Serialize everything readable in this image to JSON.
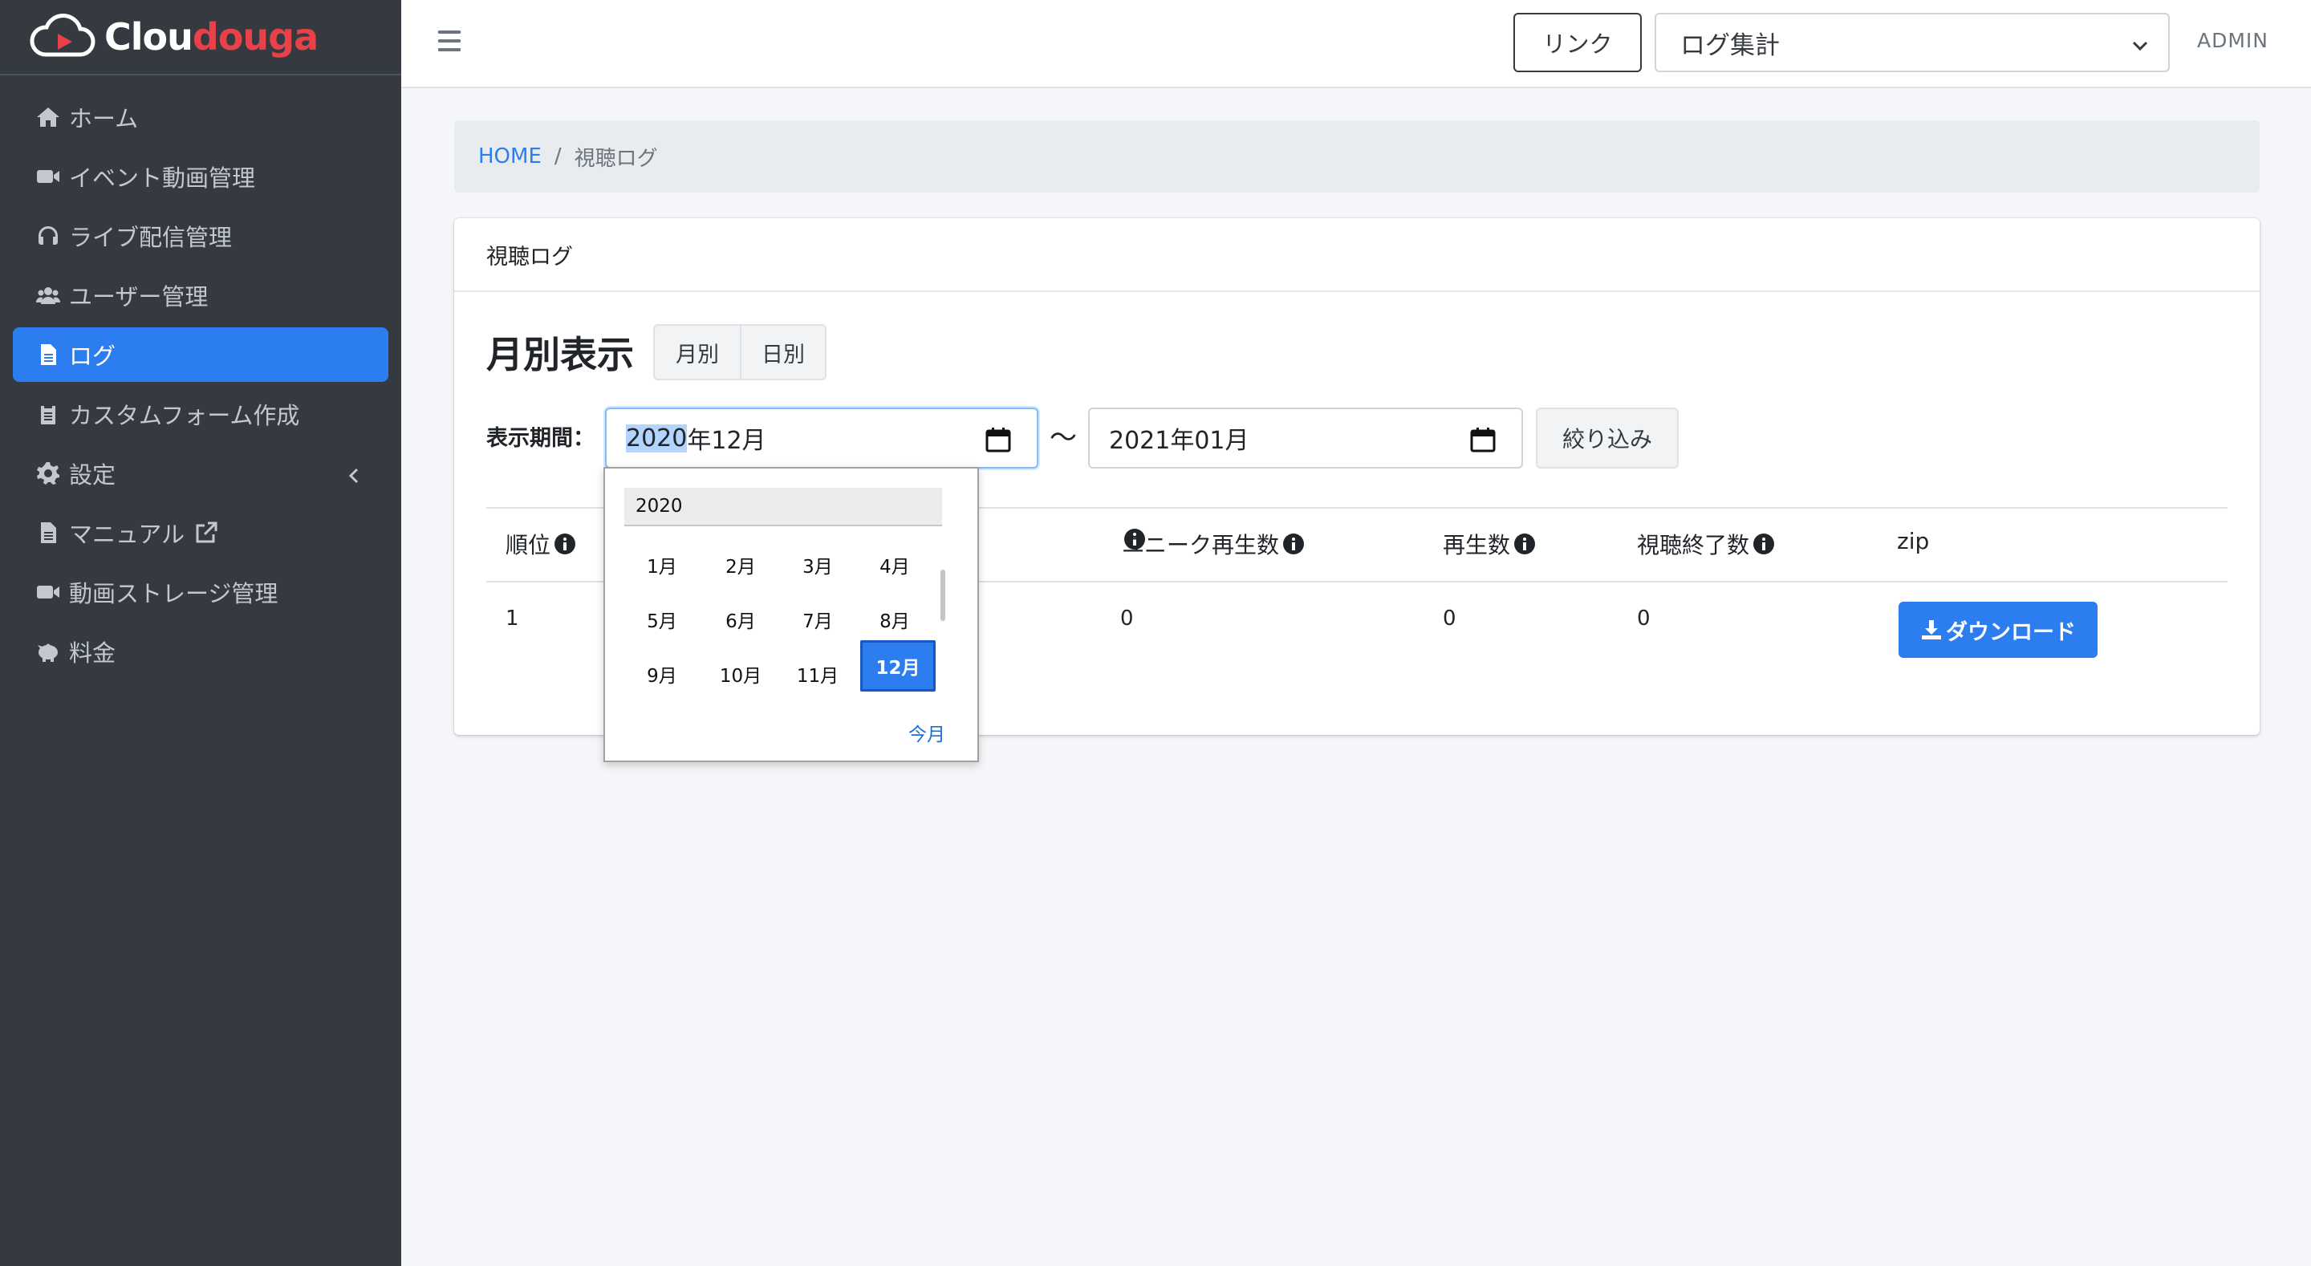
{
  "brand": {
    "name_part1": "Clou",
    "name_part2": "douga",
    "colors": {
      "accent": "#e8414a",
      "primary": "#2c7ef0",
      "sidebar_bg": "#343a40"
    }
  },
  "sidebar": {
    "items": [
      {
        "label": "ホーム",
        "icon": "home-icon"
      },
      {
        "label": "イベント動画管理",
        "icon": "video-camera-icon"
      },
      {
        "label": "ライブ配信管理",
        "icon": "headset-icon"
      },
      {
        "label": "ユーザー管理",
        "icon": "users-icon"
      },
      {
        "label": "ログ",
        "icon": "file-icon",
        "active": true
      },
      {
        "label": "カスタムフォーム作成",
        "icon": "clipboard-icon"
      },
      {
        "label": "設定",
        "icon": "gear-icon"
      },
      {
        "label": "マニュアル",
        "icon": "file-icon"
      },
      {
        "label": "動画ストレージ管理",
        "icon": "video-camera-icon"
      },
      {
        "label": "料金",
        "icon": "piggy-bank-icon"
      }
    ]
  },
  "header": {
    "link_button": "リンク",
    "select_value": "ログ集計",
    "user": "ADMIN"
  },
  "breadcrumb": {
    "home": "HOME",
    "separator": "/",
    "current": "視聴ログ"
  },
  "card": {
    "title": "視聴ログ",
    "section_title": "月別表示",
    "toggle": {
      "monthly": "月別",
      "daily": "日別"
    },
    "period_label": "表示期間：",
    "start_date": {
      "year": "2020",
      "rest": "年12月"
    },
    "tilde": "〜",
    "end_date": "2021年01月",
    "filter_button": "絞り込み"
  },
  "table": {
    "headers": {
      "rank": "順位",
      "unique_plays": "ユニーク再生数",
      "plays": "再生数",
      "finished": "視聴終了数",
      "zip": "zip"
    },
    "row": {
      "rank": "1",
      "unique_plays": "0",
      "plays": "0",
      "finished": "0",
      "download": "ダウンロード"
    }
  },
  "month_picker": {
    "year": "2020",
    "months": [
      "1月",
      "2月",
      "3月",
      "4月",
      "5月",
      "6月",
      "7月",
      "8月",
      "9月",
      "10月",
      "11月",
      "12月"
    ],
    "selected": "12月",
    "today_button": "今月"
  }
}
